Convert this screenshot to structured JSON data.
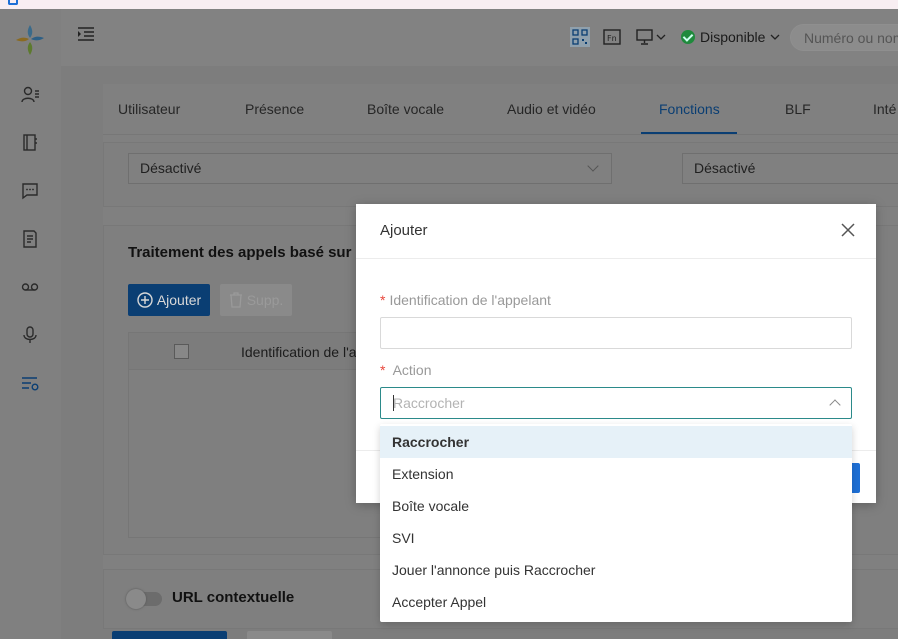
{
  "header": {
    "status_label": "Disponible",
    "search_placeholder": "Numéro ou nom"
  },
  "tabs": [
    {
      "label": "Utilisateur"
    },
    {
      "label": "Présence"
    },
    {
      "label": "Boîte vocale"
    },
    {
      "label": "Audio et vidéo"
    },
    {
      "label": "Fonctions",
      "active": true
    },
    {
      "label": "BLF"
    },
    {
      "label": "Inté"
    }
  ],
  "top_selects": {
    "left_value": "Désactivé",
    "right_value": "Désactivé"
  },
  "rules_card": {
    "title": "Traitement des appels basé sur",
    "add_label": "Ajouter",
    "delete_label": "Supp.",
    "column_header": "Identification de l'a"
  },
  "url_card": {
    "label": "URL contextuelle"
  },
  "modal": {
    "title": "Ajouter",
    "caller_id_label": "Identification de l'appelant",
    "caller_id_value": "",
    "action_label": "Action",
    "action_placeholder": "Raccrocher",
    "required_mark": "*",
    "options": [
      "Raccrocher",
      "Extension",
      "Boîte vocale",
      "SVI",
      "Jouer l'annonce puis Raccrocher",
      "Accepter Appel"
    ]
  },
  "colors": {
    "primary": "#0a3e73",
    "accent_blue": "#1d6fd6",
    "required": "#e8463b",
    "option_hover": "#e6f1f8",
    "status_green": "#1f8a3c"
  }
}
